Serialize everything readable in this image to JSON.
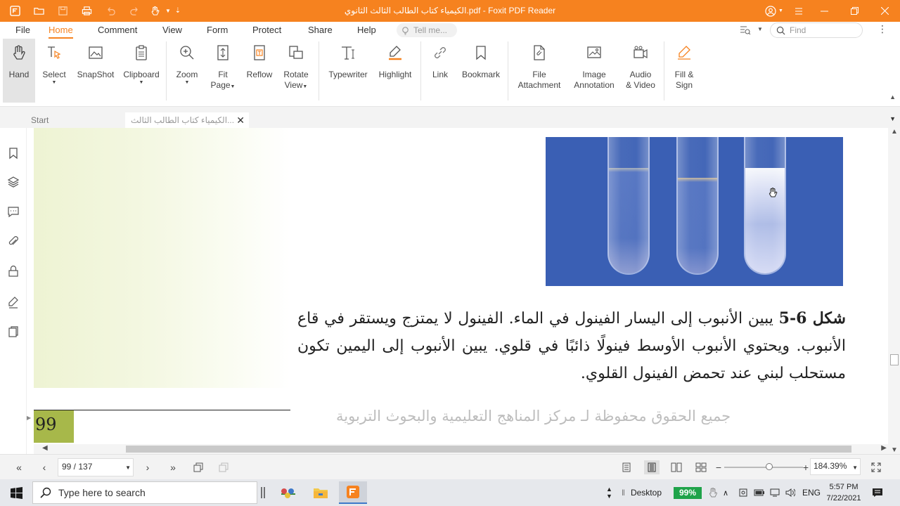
{
  "window": {
    "title": "الكيمياء كتاب الطالب الثالث الثانوي.pdf - Foxit PDF Reader"
  },
  "menu": {
    "tabs": [
      "File",
      "Home",
      "Comment",
      "View",
      "Form",
      "Protect",
      "Share",
      "Help"
    ],
    "active": "Home",
    "tell_me_placeholder": "Tell me...",
    "find_placeholder": "Find"
  },
  "ribbon": {
    "hand": "Hand",
    "select": "Select",
    "snapshot": "SnapShot",
    "clipboard": "Clipboard",
    "zoom": "Zoom",
    "fit_page_1": "Fit",
    "fit_page_2": "Page",
    "reflow": "Reflow",
    "rotate_1": "Rotate",
    "rotate_2": "View",
    "typewriter": "Typewriter",
    "highlight": "Highlight",
    "link": "Link",
    "bookmark": "Bookmark",
    "file_attach_1": "File",
    "file_attach_2": "Attachment",
    "image_annot_1": "Image",
    "image_annot_2": "Annotation",
    "audio_1": "Audio",
    "audio_2": "& Video",
    "fill_1": "Fill &",
    "fill_2": "Sign"
  },
  "doc_tabs": {
    "start": "Start",
    "active": "الكيمياء كتاب الطالب الثالث..."
  },
  "document": {
    "caption_label": "شكل 6-5",
    "caption_text": " يبين الأنبوب إلى اليسار الفينول في الماء. الفينول لا يمتزج ويستقر في قاع الأنبوب. ويحتوي الأنبوب الأوسط فينولًا ذائبًا في قلوي. يبين الأنبوب إلى اليمين تكون مستحلب لبني عند تحمض الفينول القلوي.",
    "page_number": "99",
    "footer": "جميع الحقوق محفوظة لـ مركز المناهج التعليمية والبحوث التربوية"
  },
  "status": {
    "page_display": "99 / 137",
    "zoom_level": "184.39%",
    "zoom_slider_fraction": 0.58
  },
  "taskbar": {
    "search_placeholder": "Type here to search",
    "desktop_label": "Desktop",
    "battery": "99%",
    "language": "ENG",
    "time": "5:57 PM",
    "date": "7/22/2021"
  },
  "colors": {
    "accent": "#f6821f",
    "page_number_bg": "#a7b84a",
    "photo_bg": "#3a5fb4",
    "battery": "#1fa34a"
  }
}
